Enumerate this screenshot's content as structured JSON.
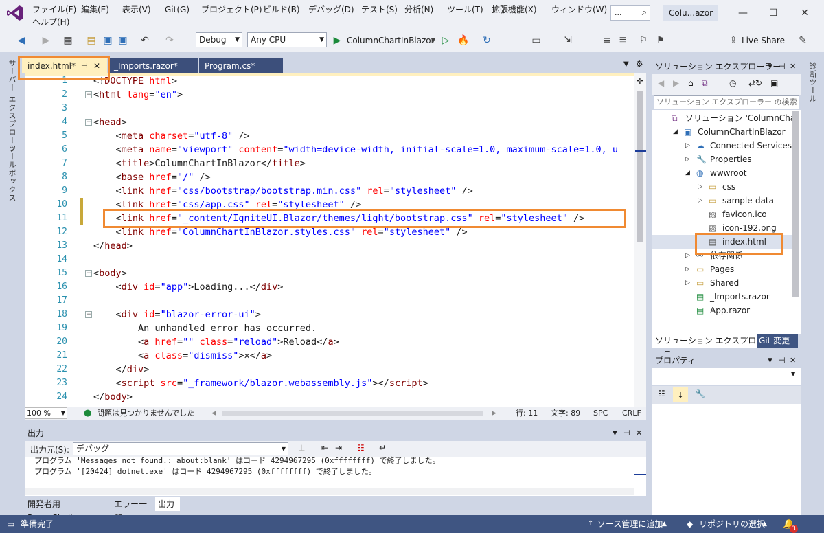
{
  "menu": {
    "items": [
      "ファイル(F)",
      "編集(E)",
      "表示(V)",
      "Git(G)",
      "プロジェクト(P)",
      "ビルド(B)",
      "デバッグ(D)",
      "テスト(S)",
      "分析(N)",
      "ツール(T)",
      "拡張機能(X)",
      "ウィンドウ(W)"
    ],
    "help": "ヘルプ(H)",
    "search_placeholder": "...",
    "window_title": "Colu...azor"
  },
  "toolbar": {
    "config": "Debug",
    "platform": "Any CPU",
    "run_target": "ColumnChartInBlazor",
    "live_share": "Live Share"
  },
  "left_strip": {
    "server_explorer": "サーバー エクスプローラー",
    "toolbox": "ツールボックス"
  },
  "right_strip": {
    "diagnostics": "診断ツール"
  },
  "tabs": [
    {
      "label": "index.html*"
    },
    {
      "label": "_Imports.razor*"
    },
    {
      "label": "Program.cs*"
    }
  ],
  "editor": {
    "lines": [
      [
        [
          "bk",
          "<!"
        ],
        [
          "tg",
          "DOCTYPE "
        ],
        [
          "at",
          "html"
        ],
        [
          "bk",
          ">"
        ]
      ],
      [
        [
          "bk",
          "<"
        ],
        [
          "tg",
          "html "
        ],
        [
          "at",
          "lang"
        ],
        [
          "bk",
          "="
        ],
        [
          "vl",
          "\"en\""
        ],
        [
          "bk",
          ">"
        ]
      ],
      [],
      [
        [
          "bk",
          "<"
        ],
        [
          "tg",
          "head"
        ],
        [
          "bk",
          ">"
        ]
      ],
      [
        [
          "bk",
          "    <"
        ],
        [
          "tg",
          "meta "
        ],
        [
          "at",
          "charset"
        ],
        [
          "bk",
          "="
        ],
        [
          "vl",
          "\"utf-8\""
        ],
        [
          "bk",
          " />"
        ]
      ],
      [
        [
          "bk",
          "    <"
        ],
        [
          "tg",
          "meta "
        ],
        [
          "at",
          "name"
        ],
        [
          "bk",
          "="
        ],
        [
          "vl",
          "\"viewport\" "
        ],
        [
          "at",
          "content"
        ],
        [
          "bk",
          "="
        ],
        [
          "vl",
          "\"width=device-width, initial-scale=1.0, maximum-scale=1.0, u"
        ]
      ],
      [
        [
          "bk",
          "    <"
        ],
        [
          "tg",
          "title"
        ],
        [
          "bk",
          ">ColumnChartInBlazor</"
        ],
        [
          "tg",
          "title"
        ],
        [
          "bk",
          ">"
        ]
      ],
      [
        [
          "bk",
          "    <"
        ],
        [
          "tg",
          "base "
        ],
        [
          "at",
          "href"
        ],
        [
          "bk",
          "="
        ],
        [
          "vl",
          "\"/\""
        ],
        [
          "bk",
          " />"
        ]
      ],
      [
        [
          "bk",
          "    <"
        ],
        [
          "tg",
          "link "
        ],
        [
          "at",
          "href"
        ],
        [
          "bk",
          "="
        ],
        [
          "vl",
          "\"css/bootstrap/bootstrap.min.css\" "
        ],
        [
          "at",
          "rel"
        ],
        [
          "bk",
          "="
        ],
        [
          "vl",
          "\"stylesheet\""
        ],
        [
          "bk",
          " />"
        ]
      ],
      [
        [
          "bk",
          "    <"
        ],
        [
          "tg",
          "link "
        ],
        [
          "at",
          "href"
        ],
        [
          "bk",
          "="
        ],
        [
          "vl",
          "\"css/app.css\" "
        ],
        [
          "at",
          "rel"
        ],
        [
          "bk",
          "="
        ],
        [
          "vl",
          "\"stylesheet\""
        ],
        [
          "bk",
          " />"
        ]
      ],
      [
        [
          "bk",
          "    <"
        ],
        [
          "tg",
          "link "
        ],
        [
          "at",
          "href"
        ],
        [
          "bk",
          "="
        ],
        [
          "vl",
          "\"_content/IgniteUI.Blazor/themes/light/bootstrap.css\" "
        ],
        [
          "at",
          "rel"
        ],
        [
          "bk",
          "="
        ],
        [
          "vl",
          "\"stylesheet\""
        ],
        [
          "bk",
          " />"
        ]
      ],
      [
        [
          "bk",
          "    <"
        ],
        [
          "tg",
          "link "
        ],
        [
          "at",
          "href"
        ],
        [
          "bk",
          "="
        ],
        [
          "vl",
          "\"ColumnChartInBlazor.styles.css\" "
        ],
        [
          "at",
          "rel"
        ],
        [
          "bk",
          "="
        ],
        [
          "vl",
          "\"stylesheet\""
        ],
        [
          "bk",
          " />"
        ]
      ],
      [
        [
          "bk",
          "</"
        ],
        [
          "tg",
          "head"
        ],
        [
          "bk",
          ">"
        ]
      ],
      [],
      [
        [
          "bk",
          "<"
        ],
        [
          "tg",
          "body"
        ],
        [
          "bk",
          ">"
        ]
      ],
      [
        [
          "bk",
          "    <"
        ],
        [
          "tg",
          "div "
        ],
        [
          "at",
          "id"
        ],
        [
          "bk",
          "="
        ],
        [
          "vl",
          "\"app\""
        ],
        [
          "bk",
          ">Loading...</"
        ],
        [
          "tg",
          "div"
        ],
        [
          "bk",
          ">"
        ]
      ],
      [],
      [
        [
          "bk",
          "    <"
        ],
        [
          "tg",
          "div "
        ],
        [
          "at",
          "id"
        ],
        [
          "bk",
          "="
        ],
        [
          "vl",
          "\"blazor-error-ui\""
        ],
        [
          "bk",
          ">"
        ]
      ],
      [
        [
          "bk",
          "        An unhandled error has occurred."
        ]
      ],
      [
        [
          "bk",
          "        <"
        ],
        [
          "tg",
          "a "
        ],
        [
          "at",
          "href"
        ],
        [
          "bk",
          "="
        ],
        [
          "vl",
          "\"\" "
        ],
        [
          "at",
          "class"
        ],
        [
          "bk",
          "="
        ],
        [
          "vl",
          "\"reload\""
        ],
        [
          "bk",
          ">Reload</"
        ],
        [
          "tg",
          "a"
        ],
        [
          "bk",
          ">"
        ]
      ],
      [
        [
          "bk",
          "        <"
        ],
        [
          "tg",
          "a "
        ],
        [
          "at",
          "class"
        ],
        [
          "bk",
          "="
        ],
        [
          "vl",
          "\"dismiss\""
        ],
        [
          "bk",
          ">✕</"
        ],
        [
          "tg",
          "a"
        ],
        [
          "bk",
          ">"
        ]
      ],
      [
        [
          "bk",
          "    </"
        ],
        [
          "tg",
          "div"
        ],
        [
          "bk",
          ">"
        ]
      ],
      [
        [
          "bk",
          "    <"
        ],
        [
          "tg",
          "script "
        ],
        [
          "at",
          "src"
        ],
        [
          "bk",
          "="
        ],
        [
          "vl",
          "\"_framework/blazor.webassembly.js\""
        ],
        [
          "bk",
          "></"
        ],
        [
          "tg",
          "script"
        ],
        [
          "bk",
          ">"
        ]
      ],
      [
        [
          "bk",
          "</"
        ],
        [
          "tg",
          "body"
        ],
        [
          "bk",
          ">"
        ]
      ]
    ],
    "line_numbers": [
      "1",
      "2",
      "3",
      "4",
      "5",
      "6",
      "7",
      "8",
      "9",
      "10",
      "11",
      "12",
      "13",
      "14",
      "15",
      "16",
      "17",
      "18",
      "19",
      "20",
      "21",
      "22",
      "23",
      "24"
    ]
  },
  "editor_status": {
    "zoom": "100 %",
    "issues": "問題は見つかりませんでした",
    "line": "行: 11",
    "col": "文字: 89",
    "spc": "SPC",
    "eol": "CRLF"
  },
  "output": {
    "title": "出力",
    "source_label": "出力元(S):",
    "source_value": "デバッグ",
    "lines": [
      "プログラム 'Messages not found.: about:blank' はコード 4294967295 (0xffffffff) で終了しました。",
      "プログラム '[20424] dotnet.exe' はコード 4294967295 (0xffffffff) で終了しました。"
    ]
  },
  "bottom_tabs": [
    "開発者用 PowerShell",
    "エラー一覧",
    "出力"
  ],
  "solution_explorer": {
    "title": "ソリューション エクスプローラー",
    "search_placeholder": "ソリューション エクスプローラー の検索",
    "items": [
      {
        "label": "ソリューション 'ColumnChartInBl",
        "icon": "solution-icon",
        "indent": 0,
        "arrow": ""
      },
      {
        "label": "ColumnChartInBlazor",
        "icon": "project-icon",
        "indent": 1,
        "arrow": "▲"
      },
      {
        "label": "Connected Services",
        "icon": "connected-services-icon",
        "indent": 2,
        "arrow": "▷"
      },
      {
        "label": "Properties",
        "icon": "properties-icon",
        "indent": 2,
        "arrow": "▷"
      },
      {
        "label": "wwwroot",
        "icon": "globe-icon",
        "indent": 2,
        "arrow": "▲"
      },
      {
        "label": "css",
        "icon": "folder-icon",
        "indent": 3,
        "arrow": "▷"
      },
      {
        "label": "sample-data",
        "icon": "folder-icon",
        "indent": 3,
        "arrow": "▷"
      },
      {
        "label": "favicon.ico",
        "icon": "image-file-icon",
        "indent": 3,
        "arrow": ""
      },
      {
        "label": "icon-192.png",
        "icon": "image-file-icon",
        "indent": 3,
        "arrow": ""
      },
      {
        "label": "index.html",
        "icon": "html-file-icon",
        "indent": 3,
        "arrow": ""
      },
      {
        "label": "依存関係",
        "icon": "dependencies-icon",
        "indent": 2,
        "arrow": "▷"
      },
      {
        "label": "Pages",
        "icon": "folder-icon",
        "indent": 2,
        "arrow": "▷"
      },
      {
        "label": "Shared",
        "icon": "folder-icon",
        "indent": 2,
        "arrow": "▷"
      },
      {
        "label": "_Imports.razor",
        "icon": "razor-file-icon",
        "indent": 2,
        "arrow": ""
      },
      {
        "label": "App.razor",
        "icon": "razor-file-icon",
        "indent": 2,
        "arrow": ""
      }
    ],
    "tab_solution": "ソリューション エクスプローラー",
    "tab_git": "Git 変更"
  },
  "properties": {
    "title": "プロパティ"
  },
  "statusbar": {
    "ready": "準備完了",
    "source_control": "ソース管理に追加",
    "repo": "リポジトリの選択",
    "notif_count": "3"
  },
  "colors": {
    "accent": "#f08a32",
    "vs_purple": "#68217a",
    "status_bg": "#3f5582"
  }
}
